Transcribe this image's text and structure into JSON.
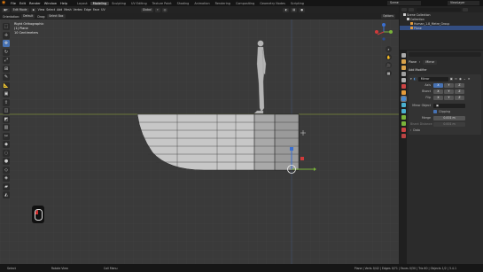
{
  "menubar": {
    "items": [
      "File",
      "Edit",
      "Render",
      "Window",
      "Help"
    ],
    "workspaces": [
      "Layout",
      "Modeling",
      "Sculpting",
      "UV Editing",
      "Texture Paint",
      "Shading",
      "Animation",
      "Rendering",
      "Compositing",
      "Geometry Nodes",
      "Scripting"
    ],
    "active_workspace": "Modeling",
    "scene": "Scene",
    "view_layer": "ViewLayer"
  },
  "viewport_header": {
    "mode": "Edit Mode",
    "menus": [
      "View",
      "Select",
      "Add",
      "Mesh",
      "Vertex",
      "Edge",
      "Face",
      "UV"
    ],
    "transform_orientation": "Global",
    "options": "Options"
  },
  "viewport_header2": {
    "orientation_label": "Orientation:",
    "orientation_value": "Default",
    "drag_label": "Drag:",
    "drag_value": "Select Box"
  },
  "overlay": {
    "view_name": "Right Orthographic",
    "object_info": "(1) Plane",
    "units": "10 Centimeters"
  },
  "outliner": {
    "rows": [
      {
        "label": "Scene Collection",
        "icon_color": "#cfcfcf",
        "selected": false
      },
      {
        "label": "Collection",
        "icon_color": "#cfcfcf",
        "selected": false
      },
      {
        "label": "Human_1.8_Metre_Group",
        "icon_color": "#e59b3a",
        "selected": false
      },
      {
        "label": "Plane",
        "icon_color": "#e59b3a",
        "selected": true
      }
    ]
  },
  "properties": {
    "object_name": "Plane",
    "modifier_chip": "Mirror",
    "add_modifier": "Add Modifier",
    "modifier_name": "Mirror",
    "axis_label": "Axis",
    "bisect_label": "Bisect",
    "flip_label": "Flip",
    "axis_options": [
      "X",
      "Y",
      "Z"
    ],
    "mirror_object_label": "Mirror Object",
    "clipping_label": "Clipping",
    "merge_label": "Merge",
    "merge_value": "0.001 m",
    "bisect_distance_label": "Bisect Distance",
    "bisect_distance_value": "0.001 m",
    "data_label": "Data"
  },
  "statusbar": {
    "left": [
      "Select",
      "Rotate View",
      "Call Menu"
    ],
    "right": "Plane | Verts 0/42 | Edges 0/71 | Faces 0/30 | Tris 60 | Objects 1/2 | 3.4.1"
  },
  "colors": {
    "accent": "#4772b3",
    "object_orange": "#e59b3a",
    "axis_red": "#d03a3a",
    "axis_green": "#7ab33a",
    "axis_blue": "#3a6fd0"
  }
}
